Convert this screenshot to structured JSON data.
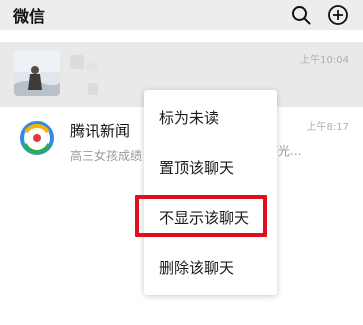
{
  "header": {
    "title": "微信",
    "icons": [
      "search-icon",
      "add-circle-icon"
    ]
  },
  "chats": [
    {
      "name": "",
      "preview": "",
      "time": "上午10:04",
      "avatar": "photo-avatar"
    },
    {
      "name": "腾讯新闻",
      "preview": "高三女孩成绩",
      "time": "上午8:17",
      "avatar": "tencent-news-logo"
    }
  ],
  "preview_tail": "寥光...",
  "context_menu": {
    "items": [
      "标为未读",
      "置顶该聊天",
      "不显示该聊天",
      "删除该聊天"
    ],
    "highlighted_index": 2,
    "highlight_color": "#e00f1e"
  }
}
